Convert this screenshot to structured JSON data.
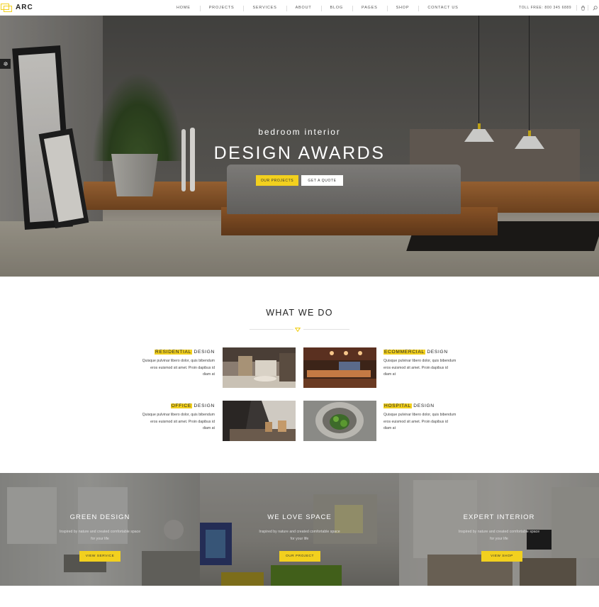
{
  "header": {
    "logo_text": "ARC",
    "nav": [
      "HOME",
      "PROJECTS",
      "SERVICES",
      "ABOUT",
      "BLOG",
      "PAGES",
      "SHOP",
      "CONTACT US"
    ],
    "toll_free": "TOLL FREE: 800 345 6889",
    "icons": [
      "cart-icon",
      "search-icon"
    ]
  },
  "hero": {
    "subtitle": "bedroom interior",
    "title": "DESIGN AWARDS",
    "btn_projects": "OUR PROJECTS",
    "btn_quote": "GET A QUOTE"
  },
  "what_we_do": {
    "title": "WHAT WE DO",
    "services": [
      {
        "highlight": "RESIDENTIAL",
        "rest": "DESIGN",
        "desc": "Quisque pulvinar libero dolor, quis bibendum eros euismod sit amet. Proin dapibus id diam at"
      },
      {
        "highlight": "ECOMMERCIAL",
        "rest": "DESIGN",
        "desc": "Quisque pulvinar libero dolor, quis bibendum eros euismod sit amet. Proin dapibus id diam at"
      },
      {
        "highlight": "OFFICE",
        "rest": "DESIGN",
        "desc": "Quisque pulvinar libero dolor, quis bibendum eros euismod sit amet. Proin dapibus id diam at"
      },
      {
        "highlight": "HOSPITAL",
        "rest": "DESIGN",
        "desc": "Quisque pulvinar libero dolor, quis bibendum eros euismod sit amet. Proin dapibus id diam at"
      }
    ]
  },
  "panels": [
    {
      "title": "GREEN DESIGN",
      "desc": "Inspired by nature and created comfortable space for your life",
      "button": "VIEW SERVICE"
    },
    {
      "title": "WE LOVE SPACE",
      "desc": "Inspired by nature and created comfortable space for your life",
      "button": "OUR PROJECT"
    },
    {
      "title": "EXPERT INTERIOR",
      "desc": "Inspired by nature and created comfortable space for your life",
      "button": "VIEW SHOP"
    }
  ],
  "colors": {
    "accent": "#f2d01e",
    "dark": "#222222"
  }
}
